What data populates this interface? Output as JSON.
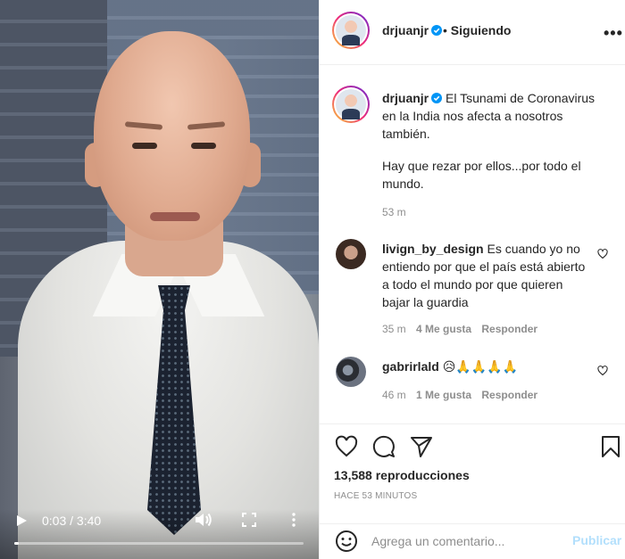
{
  "video": {
    "time_label": "0:03 / 3:40",
    "progress_fraction": 0.014,
    "icons": [
      "play-icon",
      "volume-icon",
      "fullscreen-icon",
      "more-vertical-icon"
    ]
  },
  "header": {
    "username": "drjuanjr",
    "separator": "•",
    "follow_status": "Siguiendo",
    "more": "•••"
  },
  "caption": {
    "username": "drjuanjr",
    "text_line1": "El Tsunami de Coronavirus en la India nos afecta a nosotros también.",
    "text_line2": "Hay que rezar por ellos...por todo el mundo.",
    "time": "53 m"
  },
  "comments": [
    {
      "username": "livign_by_design",
      "text": "Es cuando yo no entiendo por que el país está abierto a todo el mundo por que quieren bajar la guardia",
      "time": "35 m",
      "likes": "4 Me gusta",
      "reply": "Responder"
    },
    {
      "username": "gabrirlald",
      "text": "😥🙏🙏🙏🙏",
      "time": "46 m",
      "likes": "1 Me gusta",
      "reply": "Responder"
    }
  ],
  "actions": {
    "views": "13,588 reproducciones",
    "posted_ago": "HACE 53 MINUTOS"
  },
  "add_comment": {
    "placeholder": "Agrega un comentario...",
    "publish_label": "Publicar"
  },
  "colors": {
    "verified_blue": "#0095f6",
    "publish_disabled": "#b2dffc",
    "meta_gray": "#8e8e8e"
  }
}
